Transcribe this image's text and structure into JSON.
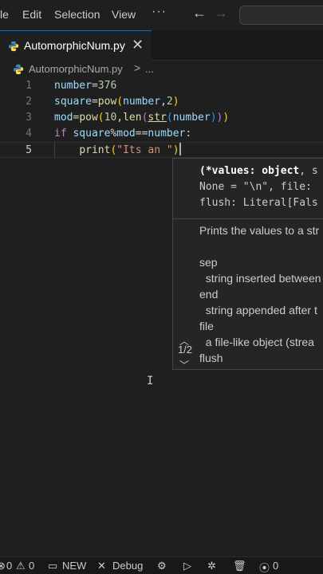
{
  "menu": {
    "file_partial": "le",
    "edit": "Edit",
    "selection": "Selection",
    "view": "View",
    "more": "···"
  },
  "nav": {
    "back_icon": "arrow-left-icon",
    "forward_icon": "arrow-right-icon"
  },
  "tab": {
    "label": "AutomorphicNum.py",
    "close": "✕",
    "icon": "python-icon"
  },
  "breadcrumb": {
    "file": "AutomorphicNum.py",
    "separator": ">",
    "more": "..."
  },
  "editor": {
    "line_numbers": [
      "1",
      "2",
      "3",
      "4",
      "5"
    ],
    "active_line": 5
  },
  "signature_help": {
    "line1_bold": "(*values: object",
    "line1_rest": ", s",
    "line2": "None = \"\\n\", file:",
    "line3": "flush: Literal[Fals",
    "doc_lines": "Prints the values to a str\n\nsep\n  string inserted between\nend\n  string appended after t\nfile\n  a file-like object (strea\nflush\n  whether to forcibly flus",
    "counter": "1/2"
  },
  "status": {
    "errors": "0",
    "warnings": "0",
    "new_label": "NEW",
    "debug_label": "Debug",
    "ports": "0"
  },
  "colors": {
    "background": "#1f1f1f",
    "accent": "#0078d4"
  }
}
